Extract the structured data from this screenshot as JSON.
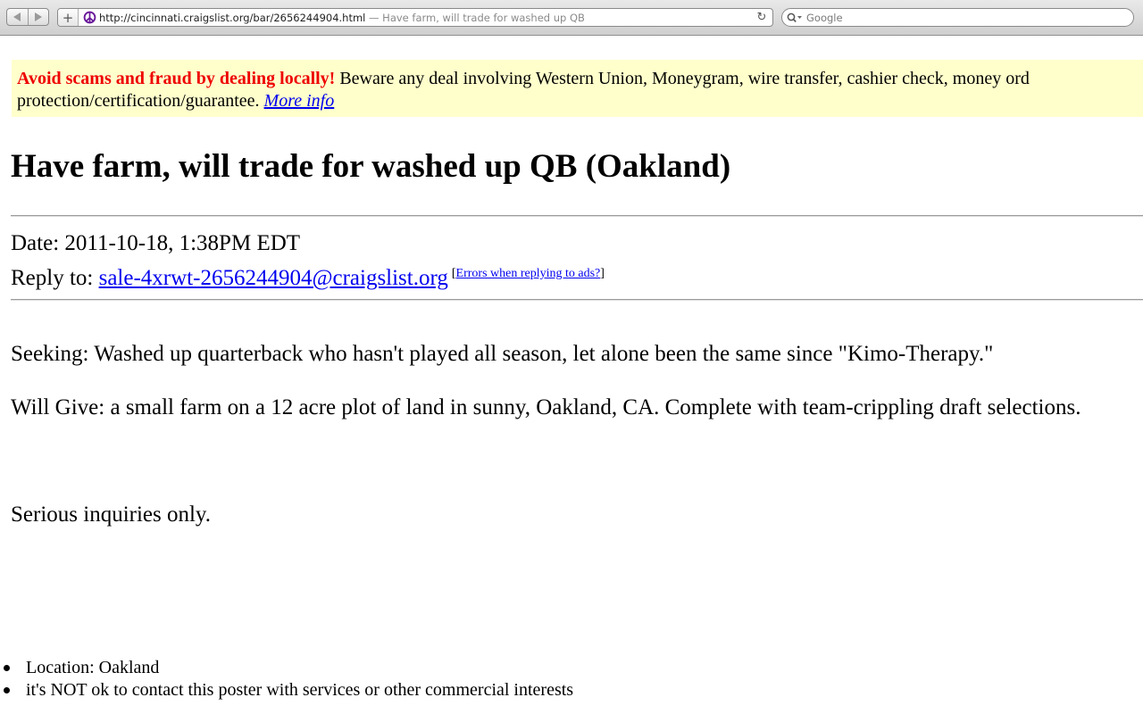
{
  "browser": {
    "url": "http://cincinnati.craigslist.org/bar/2656244904.html",
    "page_title": "— Have farm, will trade for washed up QB",
    "search_placeholder": "Google"
  },
  "scam_warning": {
    "bold_text": "Avoid scams and fraud by dealing locally!",
    "text_line1": " Beware any deal involving Western Union, Moneygram, wire transfer, cashier check, money ord",
    "text_line2": "protection/certification/guarantee. ",
    "link_text": "More info"
  },
  "posting": {
    "title": "Have farm, will trade for washed up QB (Oakland)",
    "date": "Date: 2011-10-18, 1:38PM EDT",
    "reply_label": "Reply to: ",
    "reply_email": "sale-4xrwt-2656244904@craigslist.org",
    "errors_link": "Errors when replying to ads?",
    "body": [
      "Seeking: Washed up quarterback who hasn't played all season, let alone been the same since \"Kimo-Therapy.\"",
      "Will Give: a small farm on a 12 acre plot of land in sunny, Oakland, CA. Complete with team-crippling draft selections.",
      "Serious inquiries only."
    ],
    "info": [
      "Location: Oakland",
      "it's NOT ok to contact this poster with services or other commercial interests"
    ]
  },
  "colors": {
    "warning_red": "#ee0000",
    "warning_bg": "#ffffcc",
    "link_blue": "#0000ee"
  }
}
